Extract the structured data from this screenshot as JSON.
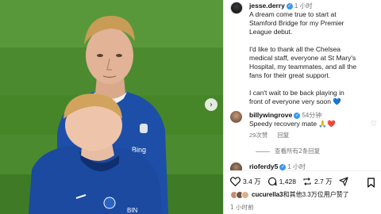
{
  "post": {
    "username": "jesse.derry",
    "time": "1 小时",
    "caption_lines": [
      "A dream come true to start at",
      "Stamford Bridge for my Premier",
      "League debut.",
      "",
      "I'd like to thank all the Chelsea",
      "medical staff, everyone at St Mary's",
      "Hospital, my teammates, and all the",
      "fans for their great support.",
      "",
      "I can't wait to be back playing in"
    ],
    "caption_last": "front of everyone very soon",
    "caption_emoji": "💙"
  },
  "comment": {
    "username": "billywingrove",
    "time": "54分钟",
    "text": "Speedy recovery mate 🙏❤️",
    "likes": "29次赞",
    "reply": "回复"
  },
  "view_replies": "查看所有2条回复",
  "comment2": {
    "username": "rioferdy5",
    "time": "1 小时"
  },
  "actions": {
    "likes_count": "3.4 万",
    "comments_count": "1,428",
    "shares_count": "2.7 万"
  },
  "liked_by": {
    "user": "cucurella3",
    "rest": "和其他3.3万位用户赞了"
  },
  "post_time": "1 小时前",
  "colors": {
    "grass": "#4c8a2f",
    "jersey": "#1d4fa8",
    "verified": "#3897f0",
    "heart_red": "#ed4956"
  },
  "icons": {
    "next": "chevron-right-icon",
    "like": "heart-icon",
    "comment": "comment-icon",
    "share": "repost-icon",
    "send": "send-icon",
    "save": "bookmark-icon"
  }
}
